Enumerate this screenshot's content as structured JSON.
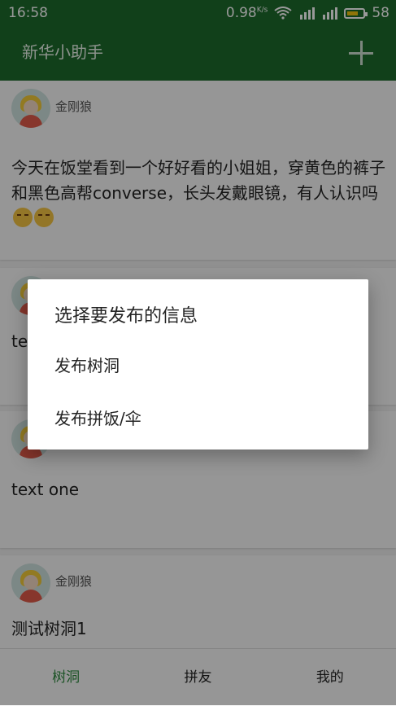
{
  "status_bar": {
    "time": "16:58",
    "network_speed": "0.98",
    "speed_unit": "K/s",
    "battery_level": "58"
  },
  "app": {
    "title": "新华小助手"
  },
  "feed": [
    {
      "author": "金刚狼",
      "text": "今天在饭堂看到一个好好看的小姐姐，穿黄色的裤子和黑色高帮converse，长头发戴眼镜，有人认识吗"
    },
    {
      "author": "",
      "text": "te"
    },
    {
      "author": "",
      "text": "text one"
    },
    {
      "author": "金刚狼",
      "text": "测试树洞1"
    }
  ],
  "dialog": {
    "title": "选择要发布的信息",
    "options": [
      "发布树洞",
      "发布拼饭/伞"
    ]
  },
  "bottom_nav": {
    "tabs": [
      "树洞",
      "拼友",
      "我的"
    ],
    "active_index": 0
  },
  "colors": {
    "primary": "#1d6b2c",
    "accent": "#2d8a3e"
  }
}
